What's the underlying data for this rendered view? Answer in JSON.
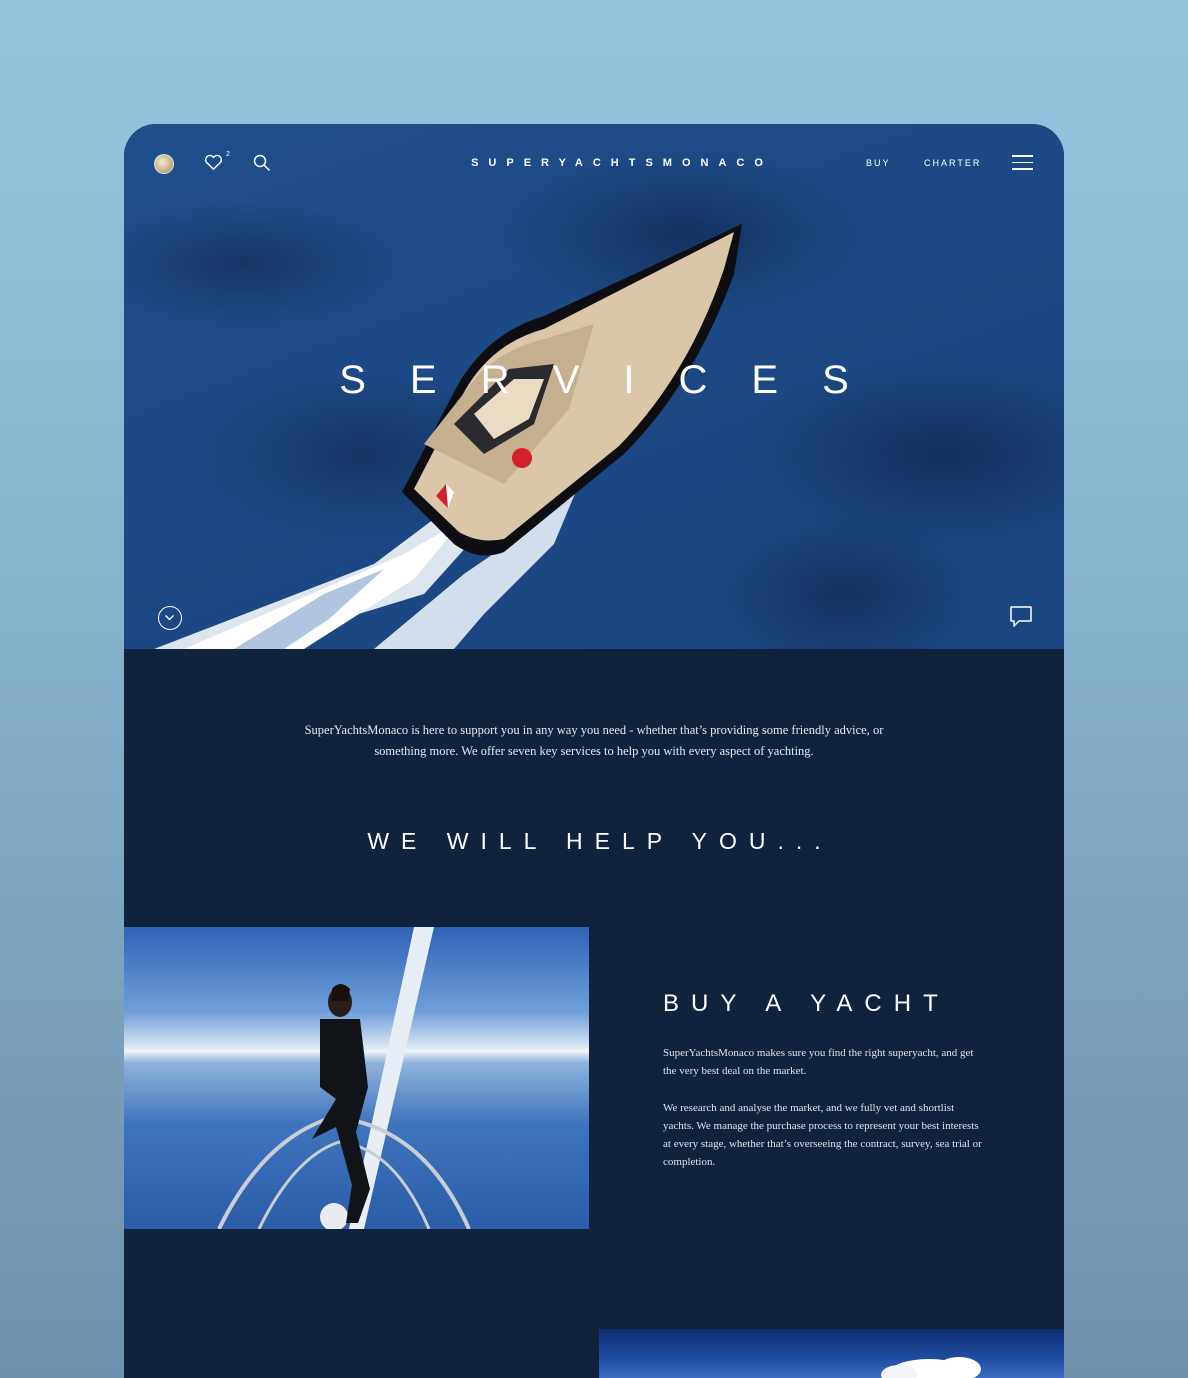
{
  "nav": {
    "brand": "SUPERYACHTSMONACO",
    "favorites_count": "2",
    "links": [
      "BUY",
      "CHARTER"
    ],
    "icons": [
      "logo-disc",
      "heart-icon",
      "search-icon",
      "menu-icon"
    ]
  },
  "hero": {
    "title": "SERVICES",
    "icons": [
      "chevron-down-icon",
      "chat-icon"
    ]
  },
  "intro": {
    "text": "SuperYachtsMonaco is here to support you in any way you need - whether that’s providing some friendly advice, or something more. We offer seven key services to help you with every aspect of yachting."
  },
  "section": {
    "heading": "WE WILL HELP YOU..."
  },
  "feature": {
    "title": "BUY A YACHT",
    "paragraphs": [
      "SuperYachtsMonaco makes sure you find the right superyacht, and get the very best deal on the market.",
      "We research and analyse the market, and we fully vet and shortlist yachts. We manage the purchase process to represent your best interests at every stage, whether that’s overseeing the contract, survey, sea trial or completion."
    ]
  },
  "colors": {
    "page_background": "#8fbfd9",
    "panel": "#11223d",
    "sea": "#1f4e8c",
    "text_light": "#ffffff"
  }
}
